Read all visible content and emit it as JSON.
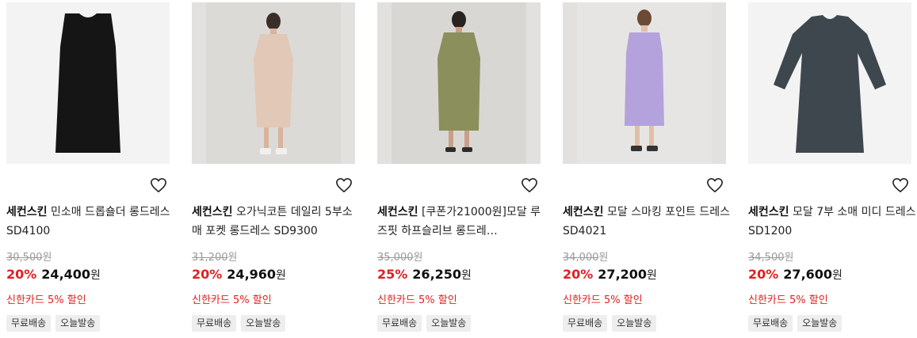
{
  "products": [
    {
      "brand": "세컨스킨",
      "name": "민소매 드롭숄더 롱드레스 SD4100",
      "original_price": "30,500",
      "discount": "20%",
      "sale_price": "24,400",
      "won": "원",
      "card_promo": "신한카드 5% 할인",
      "tags": [
        "무료배송",
        "오늘발송"
      ],
      "dress_color": "#151515"
    },
    {
      "brand": "세컨스킨",
      "name": "오가닉코튼 데일리 5부소매 포켓 롱드레스 SD9300",
      "original_price": "31,200",
      "discount": "20%",
      "sale_price": "24,960",
      "won": "원",
      "card_promo": "신한카드 5% 할인",
      "tags": [
        "무료배송",
        "오늘발송"
      ],
      "dress_color": "#e2c8b6"
    },
    {
      "brand": "세컨스킨",
      "name": "[쿠폰가21000원]모달 루즈핏 하프슬리브 롱드레…",
      "original_price": "35,000",
      "discount": "25%",
      "sale_price": "26,250",
      "won": "원",
      "card_promo": "신한카드 5% 할인",
      "tags": [
        "무료배송",
        "오늘발송"
      ],
      "dress_color": "#8b8f5c"
    },
    {
      "brand": "세컨스킨",
      "name": "모달 스마킹 포인트 드레스 SD4021",
      "original_price": "34,000",
      "discount": "20%",
      "sale_price": "27,200",
      "won": "원",
      "card_promo": "신한카드 5% 할인",
      "tags": [
        "무료배송",
        "오늘발송"
      ],
      "dress_color": "#b3a2dc"
    },
    {
      "brand": "세컨스킨",
      "name": "모달 7부 소매 미디 드레스 SD1200",
      "original_price": "34,500",
      "discount": "20%",
      "sale_price": "27,600",
      "won": "원",
      "card_promo": "신한카드 5% 할인",
      "tags": [
        "무료배송",
        "오늘발송"
      ],
      "dress_color": "#3e474e"
    }
  ],
  "icons": {
    "wishlist": "heart-outline-icon"
  },
  "colors": {
    "discount": "#e02020",
    "card_promo": "#e02020",
    "original_price": "#999999",
    "tag_bg": "#eeeeee"
  }
}
